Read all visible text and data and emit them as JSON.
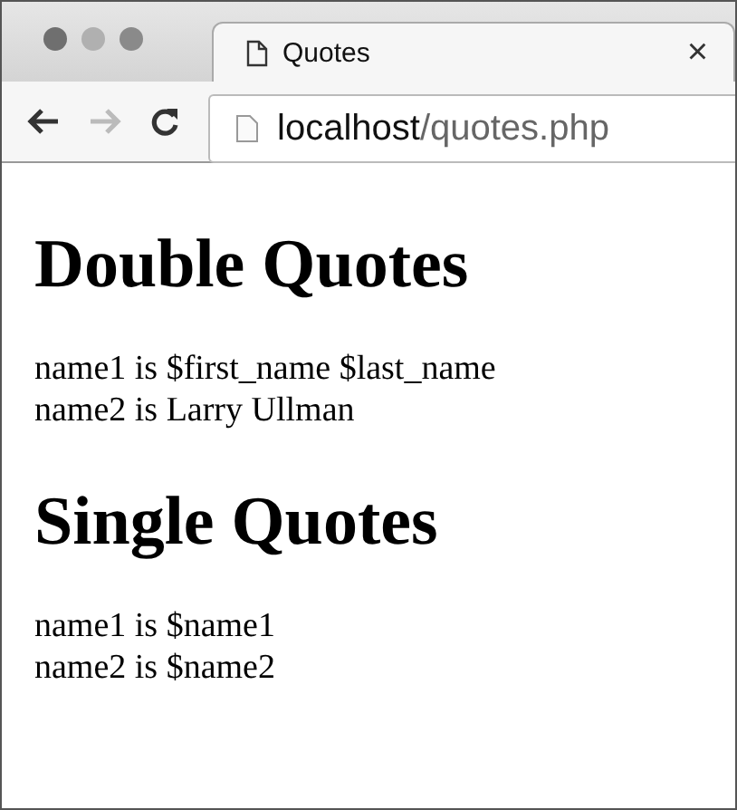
{
  "tab": {
    "title": "Quotes",
    "close": "×",
    "selected": true
  },
  "nav_buttons": [
    {
      "kind": "back",
      "disabled": false
    },
    {
      "kind": "forward",
      "disabled": true
    },
    {
      "kind": "reload",
      "disabled": false
    }
  ],
  "address": {
    "host": "localhost",
    "path": "/quotes.php"
  },
  "page": {
    "sections": [
      {
        "heading": "Double Quotes",
        "lines": [
          "name1 is $first_name $last_name",
          "name2 is Larry Ullman"
        ]
      },
      {
        "heading": "Single Quotes",
        "lines": [
          "name1 is $name1",
          "name2 is $name2"
        ]
      }
    ]
  }
}
